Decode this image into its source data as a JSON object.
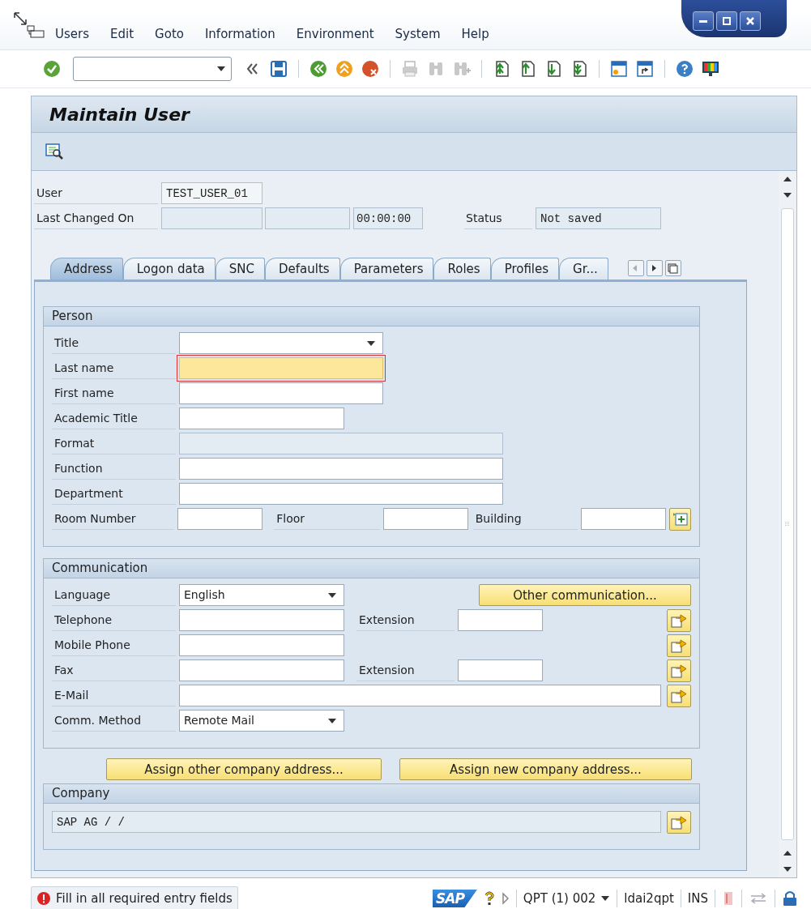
{
  "menu": [
    {
      "label": "Users"
    },
    {
      "label": "Edit"
    },
    {
      "label": "Goto"
    },
    {
      "label": "Information"
    },
    {
      "label": "Environment"
    },
    {
      "label": "System"
    },
    {
      "label": "Help"
    }
  ],
  "screen": {
    "title": "Maintain User"
  },
  "header": {
    "user": {
      "label": "User",
      "value": "TEST_USER_01"
    },
    "last_changed": {
      "label": "Last Changed On",
      "time": "00:00:00"
    },
    "status": {
      "label": "Status",
      "value": "Not saved"
    }
  },
  "tabs": [
    {
      "label": "Address",
      "selected": true
    },
    {
      "label": "Logon data",
      "selected": false
    },
    {
      "label": "SNC",
      "selected": false
    },
    {
      "label": "Defaults",
      "selected": false
    },
    {
      "label": "Parameters",
      "selected": false
    },
    {
      "label": "Roles",
      "selected": false
    },
    {
      "label": "Profiles",
      "selected": false
    },
    {
      "label": "Gr...",
      "selected": false
    }
  ],
  "person": {
    "title": "Person",
    "rows": [
      [
        {
          "kind": "dropdown",
          "label": "Title"
        }
      ],
      [
        {
          "kind": "field",
          "label": "Last name",
          "focused": true,
          "disabled": false
        }
      ],
      [
        {
          "kind": "field",
          "label": "First name",
          "focused": false,
          "disabled": false
        }
      ],
      [
        {
          "kind": "field",
          "label": "Academic Title",
          "focused": false,
          "disabled": false
        }
      ],
      [
        {
          "kind": "field",
          "label": "Format",
          "focused": false,
          "disabled": true
        }
      ],
      [
        {
          "kind": "field",
          "label": "Function",
          "focused": false,
          "disabled": false
        }
      ],
      [
        {
          "kind": "field",
          "label": "Department",
          "focused": false,
          "disabled": false
        }
      ],
      [
        {
          "kind": "field",
          "label": "Room Number",
          "focused": false,
          "disabled": false
        },
        {
          "kind": "field",
          "label": "Floor",
          "focused": false,
          "disabled": false
        },
        {
          "kind": "field",
          "label": "Building",
          "focused": false,
          "disabled": false
        },
        {
          "kind": "add_button"
        }
      ]
    ]
  },
  "communication": {
    "title": "Communication",
    "rows": [
      [
        {
          "kind": "dropdown",
          "label": "Language",
          "value": "English"
        },
        {
          "kind": "button",
          "label": "Other communication..."
        }
      ],
      [
        {
          "kind": "field",
          "label": "Telephone",
          "focused": false,
          "disabled": false
        },
        {
          "kind": "field",
          "label": "Extension",
          "focused": false,
          "disabled": false
        },
        {
          "kind": "arrow_button"
        }
      ],
      [
        {
          "kind": "field",
          "label": "Mobile Phone",
          "focused": false,
          "disabled": false
        },
        {
          "kind": "arrow_button"
        }
      ],
      [
        {
          "kind": "field",
          "label": "Fax",
          "focused": false,
          "disabled": false
        },
        {
          "kind": "field",
          "label": "Extension",
          "focused": false,
          "disabled": false
        },
        {
          "kind": "arrow_button"
        }
      ],
      [
        {
          "kind": "field",
          "label": "E-Mail",
          "focused": false,
          "disabled": false
        },
        {
          "kind": "arrow_button"
        }
      ],
      [
        {
          "kind": "dropdown",
          "label": "Comm. Method",
          "value": "Remote Mail"
        }
      ]
    ]
  },
  "company_buttons": [
    {
      "label": "Assign other company address..."
    },
    {
      "label": "Assign new company address..."
    }
  ],
  "company": {
    "title": "Company",
    "value": "SAP AG / /"
  },
  "status_bar": {
    "message": "Fill in all required entry fields",
    "logo": "SAP",
    "system": "QPT (1) 002",
    "server": "ldai2qpt",
    "mode": "INS"
  }
}
